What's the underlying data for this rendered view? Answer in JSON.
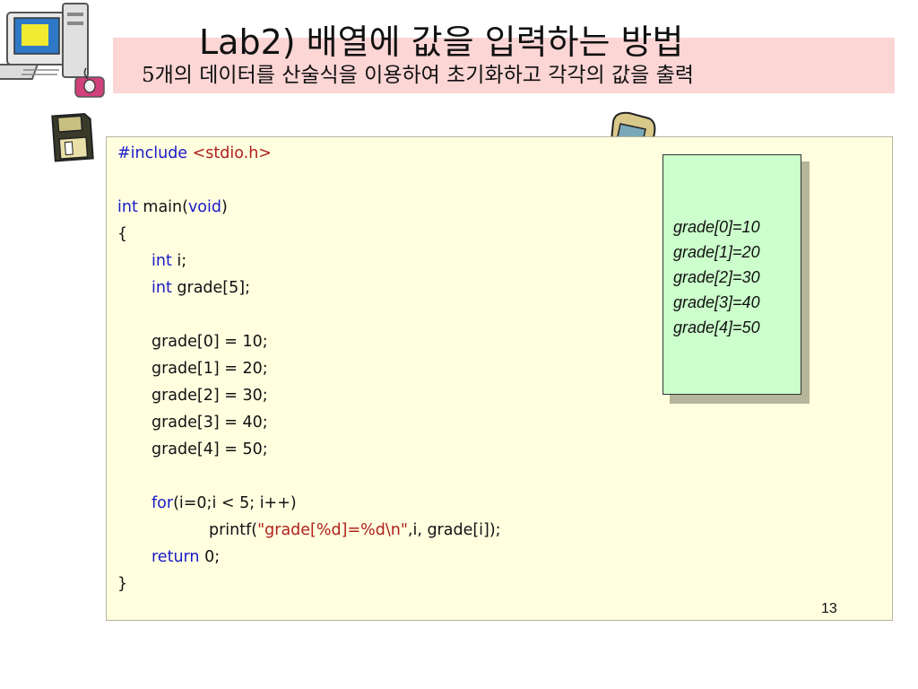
{
  "slide": {
    "title": "Lab2) 배열에 값을 입력하는 방법",
    "subtitle": "5개의 데이터를 산술식을 이용하여 초기화하고 각각의 값을 출력",
    "page_number": "13"
  },
  "code": {
    "l1": {
      "kw": "#include",
      "rest": " <stdio.h>"
    },
    "l3": {
      "kw1": "int",
      "mid": " main(",
      "kw2": "void",
      "end": ")"
    },
    "l4": "{",
    "l5": {
      "kw": "int",
      "rest": " i;"
    },
    "l6": {
      "kw": "int",
      "rest": " grade[5];"
    },
    "assign": [
      "grade[0] = 10;",
      "grade[1] = 20;",
      "grade[2] = 30;",
      "grade[3] = 40;",
      "grade[4] = 50;"
    ],
    "l14": {
      "kw": "for",
      "rest": "(i=0;i < 5; i++)"
    },
    "l15": {
      "pre": "printf(",
      "str": "\"grade[%d]=%d\\n\"",
      "post": ",i, grade[i]);"
    },
    "l16": {
      "kw": "return",
      "rest": " 0;"
    },
    "l17": "}"
  },
  "output": [
    "grade[0]=10",
    "grade[1]=20",
    "grade[2]=30",
    "grade[3]=40",
    "grade[4]=50"
  ],
  "icons": [
    "computer-icon",
    "floppy-disk-icon",
    "mobile-phone-icon"
  ],
  "colors": {
    "title_band": "#fcd5d5",
    "code_bg": "#ffffe0",
    "output_bg": "#ccffcc",
    "keyword": "#1a1ac8",
    "string": "#b0201a"
  }
}
